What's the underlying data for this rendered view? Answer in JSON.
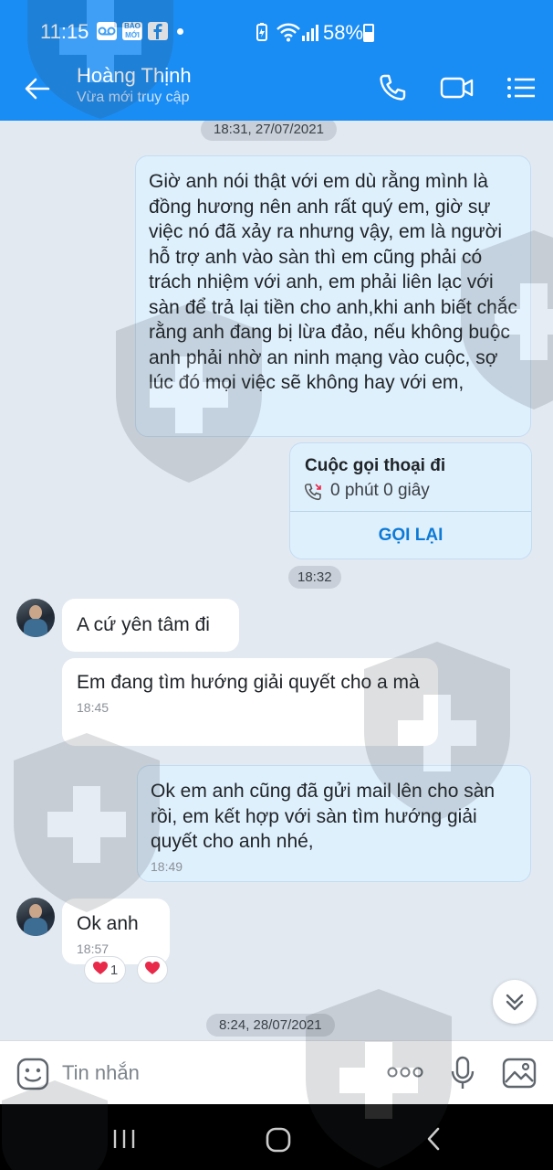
{
  "status_bar": {
    "time": "11:15",
    "app_icons": [
      "voicemail-icon",
      "bao-moi-icon",
      "facebook-icon"
    ],
    "bao_moi_label": "BÁO MỚI",
    "battery_percent": "58%",
    "battery_level": 0.58,
    "indicators": [
      "battery-saver-icon",
      "wifi-icon",
      "signal-icon"
    ]
  },
  "header": {
    "contact_name": "Hoàng Thịnh",
    "status": "Vừa mới truy cập",
    "actions": [
      "phone-icon",
      "video-call-icon",
      "menu-list-icon"
    ]
  },
  "messages": {
    "date_1": "18:31, 27/07/2021",
    "out_1_text": "Giờ anh nói thật với em dù rằng mình là đồng hương nên anh rất quý em, giờ sự việc nó đã xảy ra nhưng vậy, em là người hỗ trợ anh vào sàn thì em cũng phải có trách nhiệm với anh, em phải liên lạc với sàn để trả lại tiền cho anh,khi anh biết chắc rằng anh đang bị lừa đảo, nếu không buộc anh phải nhờ an ninh mạng vào cuộc, sợ lúc đó mọi việc sẽ không hay với em,",
    "call_title": "Cuộc gọi thoại đi",
    "call_duration": "0 phút 0 giây",
    "call_back": "GỌI LẠI",
    "time_1832": "18:32",
    "in_1_text": "A cứ yên tâm đi",
    "in_2_text": "Em đang tìm hướng giải quyết cho a mà",
    "in_2_time": "18:45",
    "out_2_text": "Ok em anh cũng đã gửi mail lên cho sàn  rồi, em kết hợp với sàn tìm hướng giải quyết cho anh nhé,",
    "out_2_time": "18:49",
    "in_3_text": "Ok anh",
    "in_3_time": "18:57",
    "reaction_count": "1",
    "date_2": "8:24, 28/07/2021"
  },
  "input": {
    "placeholder": "Tin nhắn",
    "icons": [
      "emoji-sticker-icon",
      "more-dots-icon",
      "microphone-icon",
      "image-gallery-icon"
    ]
  },
  "colors": {
    "brand_blue": "#1a8df5",
    "outgoing_bubble": "#dff0fd",
    "chat_background": "#e2e9f1",
    "reaction_red": "#e8294a"
  }
}
